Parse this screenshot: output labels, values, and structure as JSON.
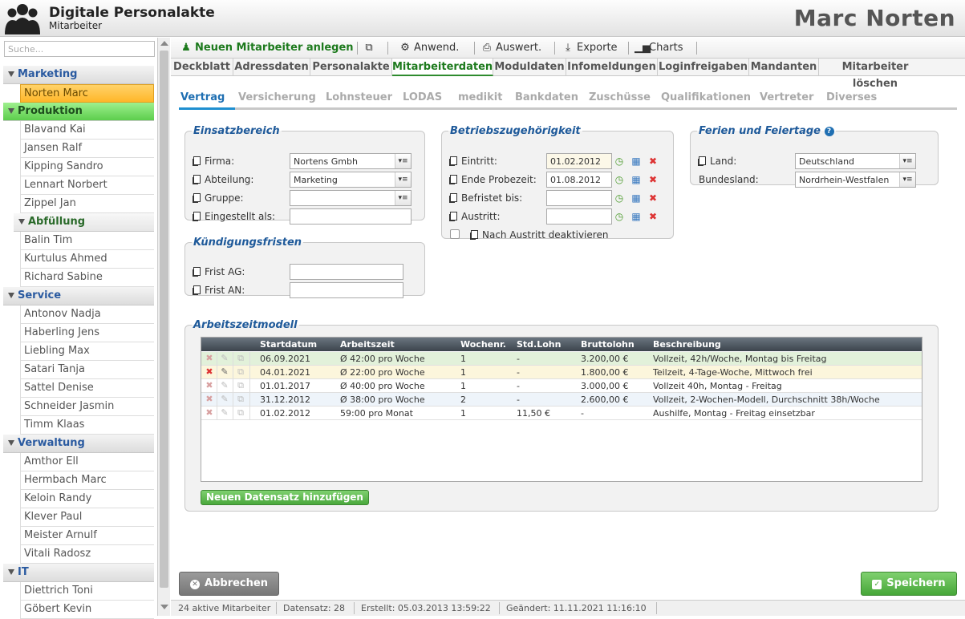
{
  "header": {
    "app_title": "Digitale Personalakte",
    "app_subtitle": "Mitarbeiter",
    "user_name": "Marc Norten"
  },
  "sidebar": {
    "search_placeholder": "Suche...",
    "groups": [
      {
        "label": "Marketing",
        "items": [
          "Norten Marc"
        ]
      },
      {
        "label": "Produktion",
        "items": [
          "Blavand Kai",
          "Jansen Ralf",
          "Kipping Sandro",
          "Lennart Norbert",
          "Zippel Jan"
        ]
      },
      {
        "label": "Abfüllung",
        "items": [
          "Balin Tim",
          "Kurtulus Ahmed",
          "Richard Sabine"
        ]
      },
      {
        "label": "Service",
        "items": [
          "Antonov Nadja",
          "Haberling Jens",
          "Liebling Max",
          "Satari Tanja",
          "Sattel Denise",
          "Schneider Jasmin",
          "Timm Klaas"
        ]
      },
      {
        "label": "Verwaltung",
        "items": [
          "Amthor Ell",
          "Hermbach Marc",
          "Keloin Randy",
          "Klever Paul",
          "Meister Arnulf",
          "Vitali Radosz"
        ]
      },
      {
        "label": "IT",
        "items": [
          "Diettrich Toni",
          "Göbert Kevin"
        ]
      }
    ]
  },
  "toolbar": {
    "new_employee": "Neuen Mitarbeiter anlegen",
    "apply": "Anwend.",
    "evaluate": "Auswert.",
    "exports": "Exporte",
    "charts": "Charts"
  },
  "main_tabs": [
    "Deckblatt",
    "Adressdaten",
    "Personalakte",
    "Mitarbeiterdaten",
    "Moduldaten",
    "Infomeldungen",
    "Loginfreigaben",
    "Mandanten",
    "Mitarbeiter löschen"
  ],
  "sub_tabs": [
    "Vertrag",
    "Versicherung",
    "Lohnsteuer",
    "LODAS",
    "medikit",
    "Bankdaten",
    "Zuschüsse",
    "Qualifikationen",
    "Vertreter",
    "Diverses"
  ],
  "einsatzbereich": {
    "legend": "Einsatzbereich",
    "firma_label": "Firma:",
    "firma_value": "Nortens Gmbh",
    "abteilung_label": "Abteilung:",
    "abteilung_value": "Marketing",
    "gruppe_label": "Gruppe:",
    "gruppe_value": "",
    "eingestellt_label": "Eingestellt als:",
    "eingestellt_value": ""
  },
  "kuendigung": {
    "legend": "Kündigungsfristen",
    "ag_label": "Frist AG:",
    "an_label": "Frist AN:"
  },
  "betrieb": {
    "legend": "Betriebszugehörigkeit",
    "eintritt_label": "Eintritt:",
    "eintritt_value": "01.02.2012",
    "probezeit_label": "Ende Probezeit:",
    "probezeit_value": "01.08.2012",
    "befristet_label": "Befristet bis:",
    "befristet_value": "",
    "austritt_label": "Austritt:",
    "austritt_value": "",
    "deactivate_label": "Nach Austritt deaktivieren"
  },
  "ferien": {
    "legend": "Ferien und Feiertage",
    "land_label": "Land:",
    "land_value": "Deutschland",
    "bundesland_label": "Bundesland:",
    "bundesland_value": "Nordrhein-Westfalen"
  },
  "arbeitszeit": {
    "legend": "Arbeitszeitmodell",
    "columns": [
      "Startdatum",
      "Arbeitszeit",
      "Wochenr.",
      "Std.Lohn",
      "Bruttolohn",
      "Beschreibung"
    ],
    "rows": [
      [
        "06.09.2021",
        "Ø 42:00 pro Woche",
        "1",
        "-",
        "3.200,00 €",
        "Vollzeit, 42h/Woche, Montag bis Freitag"
      ],
      [
        "04.01.2021",
        "Ø 22:00 pro Woche",
        "1",
        "-",
        "1.800,00 €",
        "Teilzeit, 4-Tage-Woche, Mittwoch frei"
      ],
      [
        "01.01.2017",
        "Ø 40:00 pro Woche",
        "1",
        "-",
        "3.000,00 €",
        "Vollzeit 40h, Montag - Freitag"
      ],
      [
        "31.12.2012",
        "Ø 38:00 pro Woche",
        "2",
        "-",
        "2.600,00 €",
        "Vollzeit, 2-Wochen-Modell, Durchschnitt 38h/Woche"
      ],
      [
        "01.02.2012",
        "59:00 pro Monat",
        "1",
        "11,50 €",
        "-",
        "Aushilfe, Montag - Freitag einsetzbar"
      ]
    ],
    "add_button": "Neuen Datensatz hinzufügen"
  },
  "buttons": {
    "cancel": "Abbrechen",
    "save": "Speichern"
  },
  "status": {
    "active": "24 aktive Mitarbeiter",
    "record": "Datensatz: 28",
    "created": "Erstellt: 05.03.2013 13:59:22",
    "changed": "Geändert: 11.11.2021 11:16:10"
  },
  "colors": {
    "accent_green": "#2e8b2e",
    "selected_item": "#ffb629",
    "link_blue": "#1f6fb2"
  }
}
